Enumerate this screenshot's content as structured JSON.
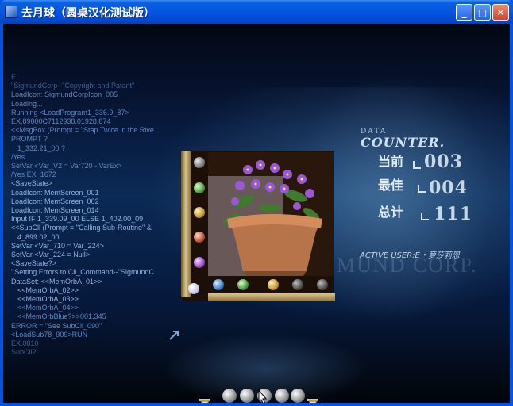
{
  "window": {
    "title": "去月球（圆桌汉化测试版）",
    "buttons": {
      "minimize": "_",
      "maximize": "□",
      "close": "✕"
    }
  },
  "console_lines": [
    "E",
    "\"SigmundCorp--\"Copyright and Patant\"",
    "LoadIcon: SigmundCorpIcon_005",
    "Loading...",
    "Running <LoadProgram1_336.9_87>",
    "EX.89000C7112938.01928.874",
    "<<MsgBox (Prompt = \"Stap Twice in the Rive",
    "PROMPT ?",
    "1_332.21_00 ?",
    "/Yes",
    "SetVar <Var_V2 = Var720 - VarEx>",
    "/Yes    EX_1672",
    "<SaveState>",
    "LoadIcon: MemScreen_001",
    "LoadIcon: MemScreen_002",
    "LoadIcon: MemScreen_014",
    "Input IF 1_339.09_00 ELSE 1_402.00_09",
    "<<SubCll (Prompt = \"Calling Sub-Routine\" &",
    "4_899.02_00",
    "SetVar <Var_710 = Var_224>",
    "SetVar <Var_224 = Null>",
    "<SaveState?>",
    "' Setting Errors to Cll_Command--\"SigmundC",
    "DataSet: <<MemOrbA_01>>",
    "<<MemOrbA_02>>",
    "<<MemOrbA_03>>",
    "<<MemOrbA_04>>",
    "<<MemOrbBlue?>>001.345",
    "ERROR = \"See SubCll_090\"",
    "<LoadSub78_909>RUN",
    "EX.0810",
    "SubCll2"
  ],
  "counter": {
    "data_label": "DATA",
    "counter_label": "COUNTER.",
    "current_label": "当前",
    "current_value": "003",
    "best_label": "最佳",
    "best_value": "004",
    "total_label": "总计",
    "total_value": "111",
    "active_user": "ACTIVE USER:E・萝莎莉恩"
  },
  "watermark": "MUND CORP.",
  "puzzle": {
    "left_orbs": [
      "gray",
      "green",
      "gold",
      "red",
      "violet"
    ],
    "bottom_orbs": [
      "white",
      "blue",
      "green",
      "gold",
      "dark",
      "dark"
    ],
    "image": "flower-pot"
  },
  "tray": {
    "orbs": 5
  },
  "icons": [
    "app-icon",
    "hourglass-icon",
    "arrow-icon",
    "cursor-icon"
  ]
}
